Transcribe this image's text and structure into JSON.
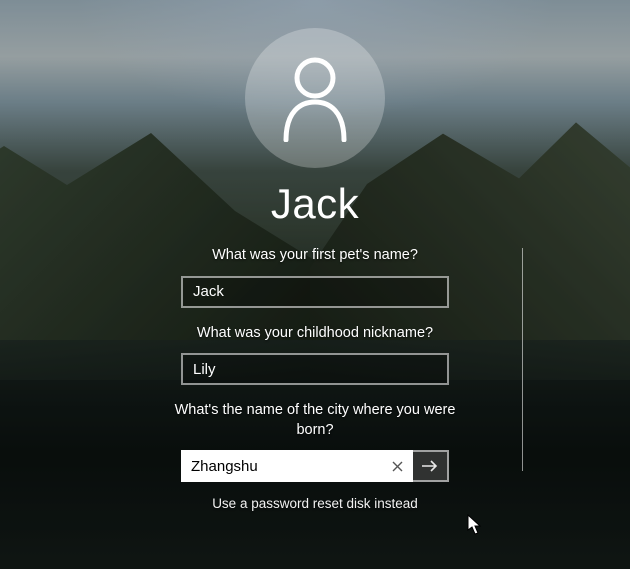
{
  "user": {
    "display_name": "Jack"
  },
  "questions": {
    "q1": {
      "label": "What was your first pet's name?",
      "value": "Jack"
    },
    "q2": {
      "label": "What was your childhood nickname?",
      "value": "Lily"
    },
    "q3": {
      "label": "What's the name of the city where you were born?",
      "value": "Zhangshu"
    }
  },
  "links": {
    "reset_disk": "Use a password reset disk instead"
  },
  "icons": {
    "avatar": "user-icon",
    "clear": "clear-icon",
    "submit": "arrow-right-icon",
    "cursor": "mouse-cursor"
  }
}
